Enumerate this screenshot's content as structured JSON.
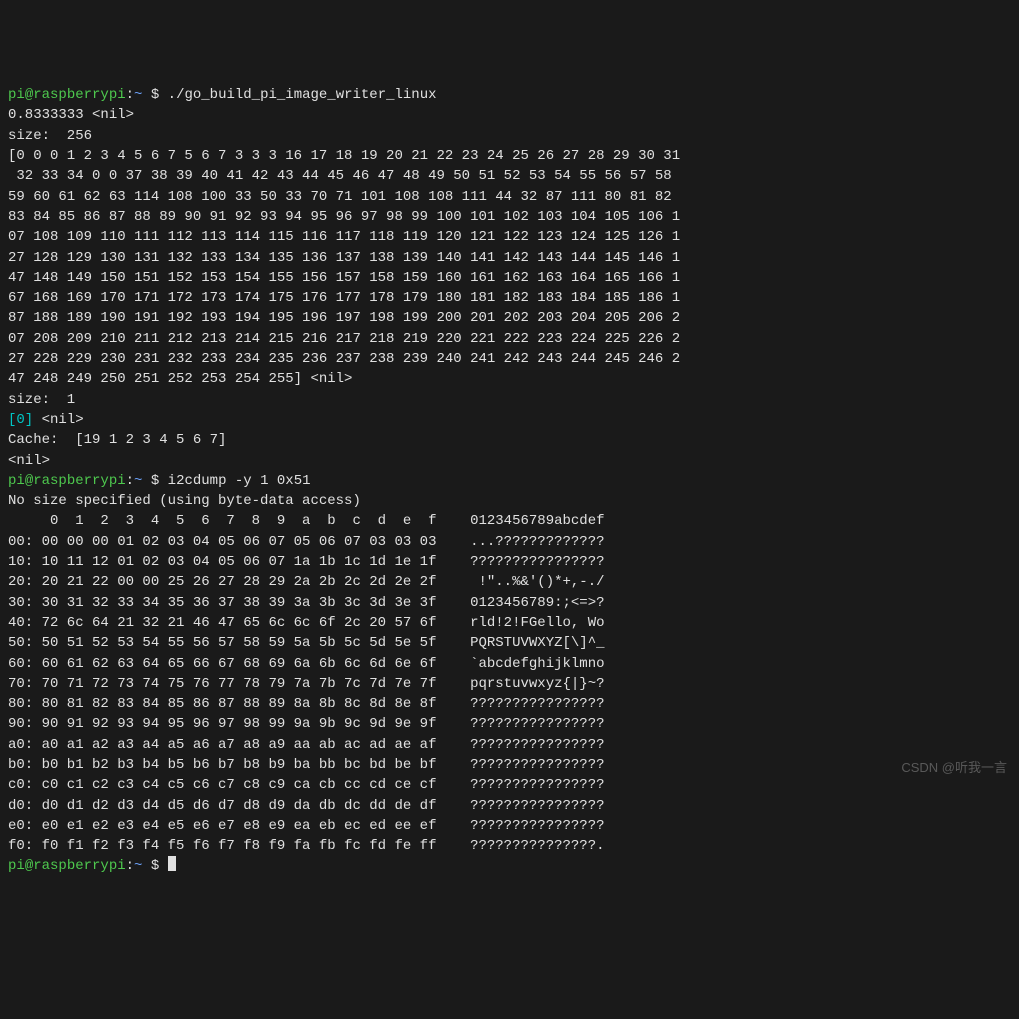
{
  "prompt": {
    "user": "pi",
    "host": "raspberrypi",
    "at": "@",
    "sep1": ":",
    "path": "~",
    "sep2": " $ "
  },
  "cmd1": "./go_build_pi_image_writer_linux",
  "out1": {
    "line1": "0.8333333 <nil>",
    "line2": "size:  256",
    "array_lines": [
      "[0 0 0 1 2 3 4 5 6 7 5 6 7 3 3 3 16 17 18 19 20 21 22 23 24 25 26 27 28 29 30 31",
      " 32 33 34 0 0 37 38 39 40 41 42 43 44 45 46 47 48 49 50 51 52 53 54 55 56 57 58 ",
      "59 60 61 62 63 114 108 100 33 50 33 70 71 101 108 108 111 44 32 87 111 80 81 82 ",
      "83 84 85 86 87 88 89 90 91 92 93 94 95 96 97 98 99 100 101 102 103 104 105 106 1",
      "07 108 109 110 111 112 113 114 115 116 117 118 119 120 121 122 123 124 125 126 1",
      "27 128 129 130 131 132 133 134 135 136 137 138 139 140 141 142 143 144 145 146 1",
      "47 148 149 150 151 152 153 154 155 156 157 158 159 160 161 162 163 164 165 166 1",
      "67 168 169 170 171 172 173 174 175 176 177 178 179 180 181 182 183 184 185 186 1",
      "87 188 189 190 191 192 193 194 195 196 197 198 199 200 201 202 203 204 205 206 2",
      "07 208 209 210 211 212 213 214 215 216 217 218 219 220 221 222 223 224 225 226 2",
      "27 228 229 230 231 232 233 234 235 236 237 238 239 240 241 242 243 244 245 246 2",
      "47 248 249 250 251 252 253 254 255] <nil>"
    ],
    "size1": "size:  1",
    "zero_line_cyan": "[0]",
    "zero_line_rest": " <nil>",
    "cache": "Cache:  [19 1 2 3 4 5 6 7]",
    "nil2": "<nil>"
  },
  "cmd2": "i2cdump -y 1 0x51",
  "out2": {
    "msg": "No size specified (using byte-data access)",
    "header": "     0  1  2  3  4  5  6  7  8  9  a  b  c  d  e  f    0123456789abcdef",
    "rows": [
      "00: 00 00 00 01 02 03 04 05 06 07 05 06 07 03 03 03    ...?????????????",
      "10: 10 11 12 01 02 03 04 05 06 07 1a 1b 1c 1d 1e 1f    ????????????????",
      "20: 20 21 22 00 00 25 26 27 28 29 2a 2b 2c 2d 2e 2f     !\"..%&'()*+,-./",
      "30: 30 31 32 33 34 35 36 37 38 39 3a 3b 3c 3d 3e 3f    0123456789:;<=>?",
      "40: 72 6c 64 21 32 21 46 47 65 6c 6c 6f 2c 20 57 6f    rld!2!FGello, Wo",
      "50: 50 51 52 53 54 55 56 57 58 59 5a 5b 5c 5d 5e 5f    PQRSTUVWXYZ[\\]^_",
      "60: 60 61 62 63 64 65 66 67 68 69 6a 6b 6c 6d 6e 6f    `abcdefghijklmno",
      "70: 70 71 72 73 74 75 76 77 78 79 7a 7b 7c 7d 7e 7f    pqrstuvwxyz{|}~?",
      "80: 80 81 82 83 84 85 86 87 88 89 8a 8b 8c 8d 8e 8f    ????????????????",
      "90: 90 91 92 93 94 95 96 97 98 99 9a 9b 9c 9d 9e 9f    ????????????????",
      "a0: a0 a1 a2 a3 a4 a5 a6 a7 a8 a9 aa ab ac ad ae af    ????????????????",
      "b0: b0 b1 b2 b3 b4 b5 b6 b7 b8 b9 ba bb bc bd be bf    ????????????????",
      "c0: c0 c1 c2 c3 c4 c5 c6 c7 c8 c9 ca cb cc cd ce cf    ????????????????",
      "d0: d0 d1 d2 d3 d4 d5 d6 d7 d8 d9 da db dc dd de df    ????????????????",
      "e0: e0 e1 e2 e3 e4 e5 e6 e7 e8 e9 ea eb ec ed ee ef    ????????????????",
      "f0: f0 f1 f2 f3 f4 f5 f6 f7 f8 f9 fa fb fc fd fe ff    ???????????????."
    ]
  },
  "watermark": "CSDN @听我一言"
}
